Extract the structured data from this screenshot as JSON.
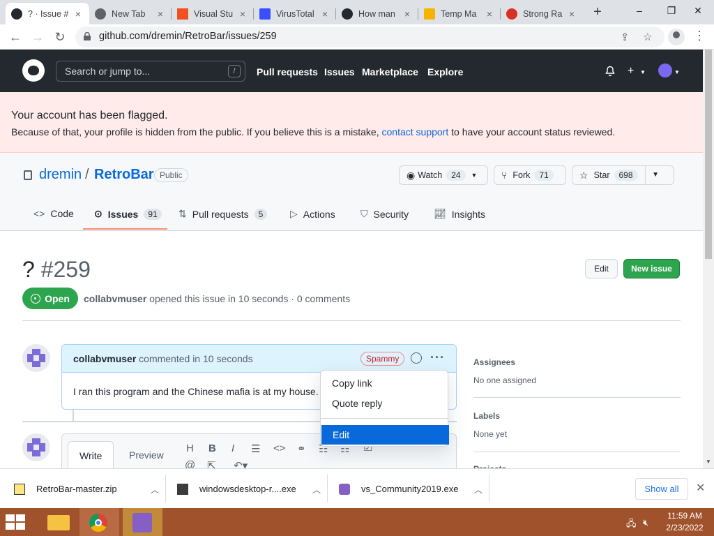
{
  "browser": {
    "tabs": [
      {
        "title": "? · Issue #",
        "favicon": "github-icon",
        "color": "#24292f",
        "active": true
      },
      {
        "title": "New Tab",
        "favicon": "chrome-icon",
        "color": "#5f6368",
        "active": false
      },
      {
        "title": "Visual Stu",
        "favicon": "windows-icon",
        "color": "#f25022",
        "active": false
      },
      {
        "title": "VirusTotal",
        "favicon": "virustotal-icon",
        "color": "#394eff",
        "active": false
      },
      {
        "title": "How man",
        "favicon": "github-icon",
        "color": "#24292f",
        "active": false
      },
      {
        "title": "Temp Ma",
        "favicon": "mail-icon",
        "color": "#f4b400",
        "active": false
      },
      {
        "title": "Strong Ra",
        "favicon": "strong-icon",
        "color": "#d93025",
        "active": false
      }
    ],
    "new_tab": "+",
    "window_controls": {
      "minimize": "–",
      "restore": "❐",
      "close": "✕"
    },
    "url": "github.com/dremin/RetroBar/issues/259"
  },
  "gh": {
    "search_placeholder": "Search or jump to...",
    "search_key": "/",
    "nav": [
      "Pull requests",
      "Issues",
      "Marketplace",
      "Explore"
    ],
    "plus": "+"
  },
  "flag": {
    "title": "Your account has been flagged.",
    "text_before": "Because of that, your profile is hidden from the public. If you believe this is a mistake, ",
    "link": "contact support",
    "text_after": " to have your account status reviewed."
  },
  "repo": {
    "owner": "dremin",
    "sep": "/",
    "name": "RetroBar",
    "visibility": "Public",
    "watch": {
      "label": "Watch",
      "count": "24"
    },
    "fork": {
      "label": "Fork",
      "count": "71"
    },
    "star": {
      "label": "Star",
      "count": "698"
    },
    "tabs": [
      {
        "label": "Code",
        "count": null
      },
      {
        "label": "Issues",
        "count": "91"
      },
      {
        "label": "Pull requests",
        "count": "5"
      },
      {
        "label": "Actions",
        "count": null
      },
      {
        "label": "Security",
        "count": null
      },
      {
        "label": "Insights",
        "count": null
      }
    ]
  },
  "issue": {
    "title": "?",
    "number": "#259",
    "edit_label": "Edit",
    "new_issue_label": "New issue",
    "state": "Open",
    "author": "collabvmuser",
    "meta_rest": "opened this issue in 10 seconds · 0 comments"
  },
  "comment": {
    "author": "collabvmuser",
    "when": "commented in 10 seconds",
    "badge": "Spammy",
    "body": "I ran this program and the Chinese mafia is at my house."
  },
  "menu": {
    "items": [
      "Copy link",
      "Quote reply",
      "Edit"
    ],
    "highlighted": "Edit"
  },
  "compose": {
    "tabs": [
      "Write",
      "Preview"
    ]
  },
  "sidebar": {
    "assignees_title": "Assignees",
    "assignees_value": "No one assigned",
    "labels_title": "Labels",
    "labels_value": "None yet",
    "projects_title": "Projects"
  },
  "downloads": {
    "items": [
      "RetroBar-master.zip",
      "windowsdesktop-r....exe",
      "vs_Community2019.exe"
    ],
    "show_all": "Show all"
  },
  "taskbar": {
    "time": "11:59 AM",
    "date": "2/23/2022"
  }
}
